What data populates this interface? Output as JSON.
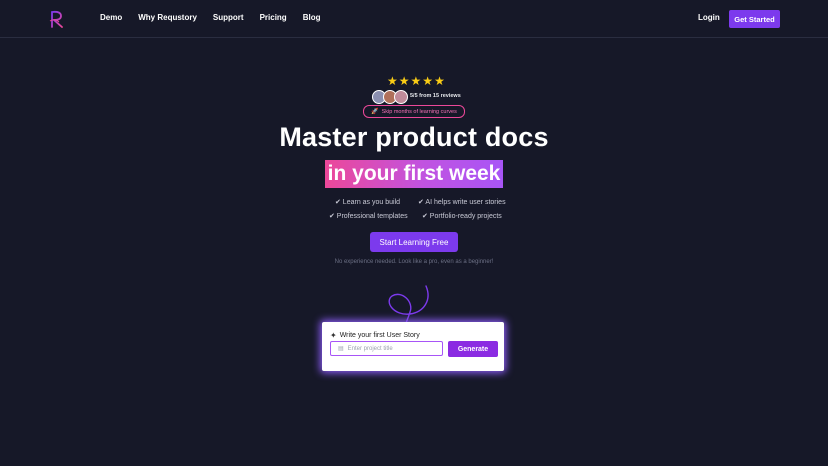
{
  "nav": {
    "links": [
      "Demo",
      "Why Requstory",
      "Support",
      "Pricing",
      "Blog"
    ],
    "login_label": "Login",
    "cta_label": "Get Started",
    "accent": "#7c3aed"
  },
  "hero": {
    "rating_stars": 5,
    "review_text": "5/5 from 15 reviews",
    "pill_text": "Skip months of learning curves",
    "headline": "Master product docs",
    "highlight": "in your first week",
    "features": [
      "✔ Learn as you build",
      "✔ AI helps write user stories",
      "✔ Professional templates",
      "✔ Portfolio-ready projects"
    ],
    "cta_label": "Start Learning Free",
    "subnote": "No experience needed. Look like a pro, even as a beginner!"
  },
  "card": {
    "title": "Write your first User Story",
    "input_placeholder": "Enter project title",
    "generate_label": "Generate"
  }
}
